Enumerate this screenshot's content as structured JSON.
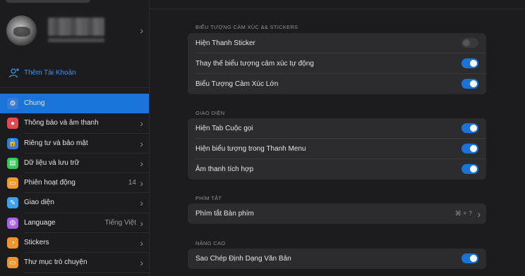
{
  "sidebar": {
    "add_account": "Thêm Tài Khoản",
    "items": [
      {
        "label": "Chung",
        "icon": "gear-icon",
        "color": "#3a7bd5",
        "active": true,
        "glyph": "⚙"
      },
      {
        "label": "Thông báo và âm thanh",
        "icon": "bell-icon",
        "color": "#e5484d",
        "glyph": "●"
      },
      {
        "label": "Riêng tư và bảo mật",
        "icon": "lock-icon",
        "color": "#2f7de1",
        "glyph": "🔒"
      },
      {
        "label": "Dữ liệu và lưu trữ",
        "icon": "database-icon",
        "color": "#34c759",
        "glyph": "▤"
      },
      {
        "label": "Phiên hoạt động",
        "icon": "devices-icon",
        "color": "#f09a2b",
        "glyph": "▭",
        "value": "14"
      },
      {
        "label": "Giao diện",
        "icon": "brush-icon",
        "color": "#3aa1f2",
        "glyph": "✎"
      },
      {
        "label": "Language",
        "icon": "globe-icon",
        "color": "#a862ea",
        "glyph": "◍",
        "value": "Tiếng Việt"
      },
      {
        "label": "Stickers",
        "icon": "sticker-icon",
        "color": "#f0952b",
        "glyph": "◔"
      },
      {
        "label": "Thư mục trò chuyện",
        "icon": "folder-icon",
        "color": "#f0952b",
        "glyph": "▭"
      }
    ]
  },
  "main": {
    "sections": [
      {
        "header": "BIỂU TƯỢNG CẢM XÚC && STICKERS",
        "rows": [
          {
            "label": "Hiện Thanh Sticker",
            "on": false
          },
          {
            "label": "Thay thế biểu tượng cảm xúc tự động",
            "on": true
          },
          {
            "label": "Biểu Tượng Cảm Xúc Lớn",
            "on": true
          }
        ]
      },
      {
        "header": "GIAO DIỆN",
        "rows": [
          {
            "label": "Hiện Tab Cuộc gọi",
            "on": true
          },
          {
            "label": "Hiện biểu tượng trong Thanh Menu",
            "on": true
          },
          {
            "label": "Âm thanh tích hợp",
            "on": true
          }
        ]
      },
      {
        "header": "PHÍM TẮT",
        "rows": [
          {
            "label": "Phím tắt Bàn phím",
            "shortcut": "⌘ + ?"
          }
        ]
      },
      {
        "header": "NÂNG CAO",
        "rows": [
          {
            "label": "Sao Chép Định Dạng Văn Bản",
            "on": true
          }
        ]
      }
    ]
  },
  "colors": {
    "accent": "#1a73d9",
    "background": "#1c1c1e",
    "card": "#2c2c2e"
  }
}
